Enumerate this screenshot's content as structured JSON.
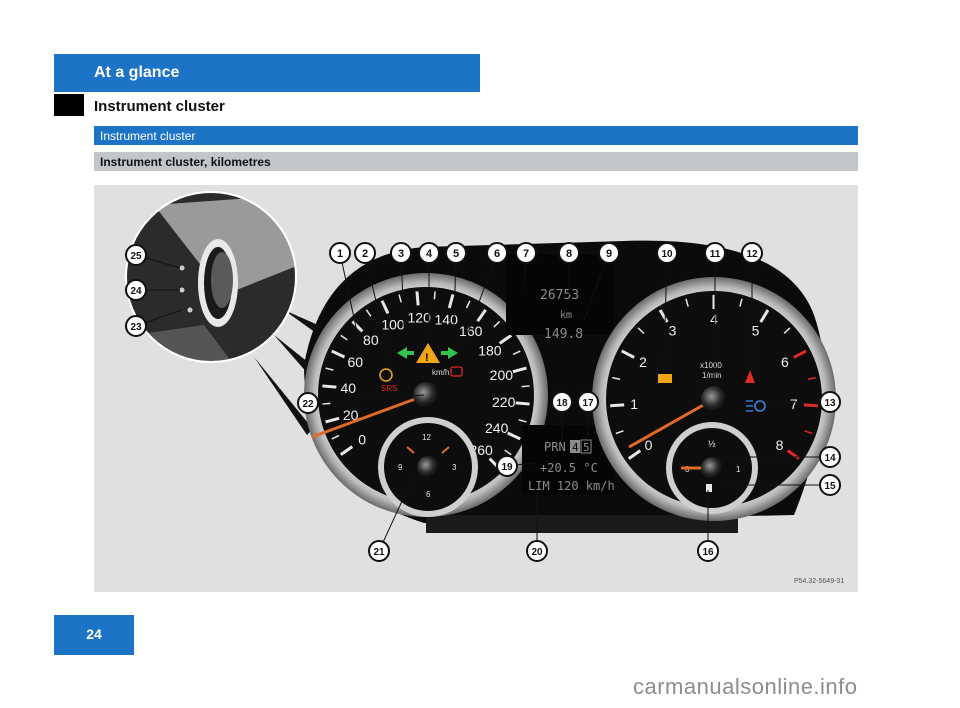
{
  "header": {
    "title": "At a glance",
    "subtitle": "Instrument cluster"
  },
  "section": {
    "title": "Instrument cluster"
  },
  "subsection": {
    "title": "Instrument cluster, kilometres"
  },
  "figure": {
    "ref_code": "P54.32-5649-31",
    "callouts": [
      "1",
      "2",
      "3",
      "4",
      "5",
      "6",
      "7",
      "8",
      "9",
      "10",
      "11",
      "12",
      "13",
      "14",
      "15",
      "16",
      "17",
      "18",
      "19",
      "20",
      "21",
      "22",
      "23",
      "24",
      "25"
    ],
    "speedometer": {
      "ticks": [
        "0",
        "20",
        "40",
        "60",
        "80",
        "100",
        "120",
        "140",
        "160",
        "180",
        "200",
        "220",
        "240",
        "260"
      ],
      "unit": "km/h",
      "srs": "SRS"
    },
    "display": {
      "odometer": "26753",
      "odo_unit": "km",
      "trip": "149.8",
      "gear": "PRN",
      "gear_active": "4",
      "gear_next": "5",
      "temperature": "+20.5 °C",
      "limit": "LIM 120 km/h"
    },
    "tachometer": {
      "ticks": [
        "0",
        "1",
        "2",
        "3",
        "4",
        "5",
        "6",
        "7",
        "8"
      ],
      "unit_top": "x1000",
      "unit_bottom": "1/min"
    },
    "clock": {
      "ticks": [
        "12",
        "3",
        "6",
        "9"
      ]
    },
    "fuel": {
      "ticks": [
        "0",
        "½",
        "1"
      ]
    },
    "colors": {
      "accent": "#1d74c6",
      "warning_red": "#e02828",
      "amber": "#f2a516",
      "green": "#33c24d",
      "needle": "#e06a28"
    }
  },
  "page": {
    "number": "24"
  },
  "watermark": {
    "text": "carmanualsonline.info"
  }
}
